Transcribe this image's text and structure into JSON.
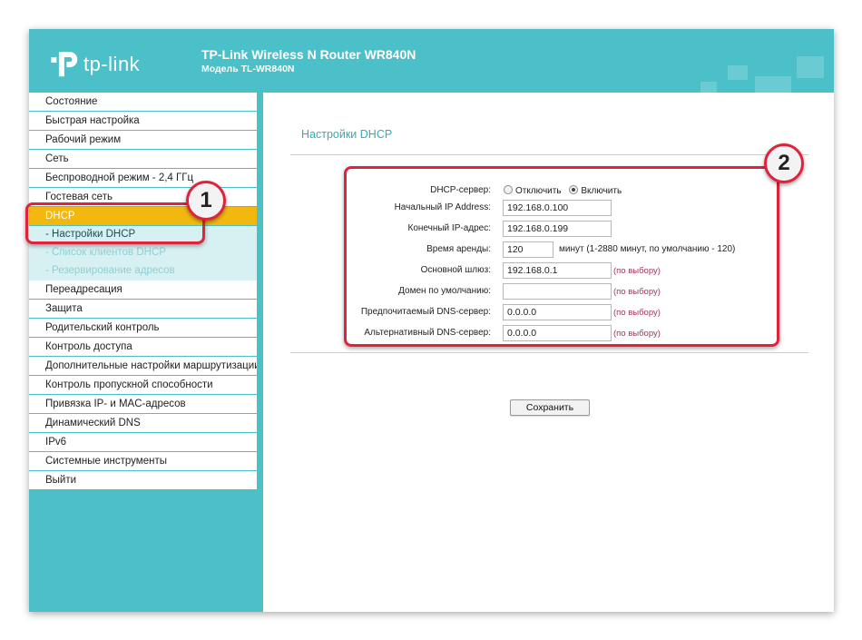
{
  "header": {
    "logo_text": "tp-link",
    "product_title": "TP-Link Wireless N Router WR840N",
    "product_model": "Модель TL-WR840N",
    "logo_icon": "tp-link-logo-icon"
  },
  "sidebar": {
    "items": [
      {
        "label": "Состояние"
      },
      {
        "label": "Быстрая настройка"
      },
      {
        "label": "Рабочий режим"
      },
      {
        "label": "Сеть"
      },
      {
        "label": "Беспроводной режим - 2,4 ГГц"
      },
      {
        "label": "Гостевая сеть"
      },
      {
        "label": "DHCP"
      },
      {
        "label": "- Настройки DHCP"
      },
      {
        "label": "- Список клиентов DHCP"
      },
      {
        "label": "- Резервирование адресов"
      },
      {
        "label": "Переадресация"
      },
      {
        "label": "Защита"
      },
      {
        "label": "Родительский контроль"
      },
      {
        "label": "Контроль доступа"
      },
      {
        "label": "Дополнительные настройки маршрутизации"
      },
      {
        "label": "Контроль пропускной способности"
      },
      {
        "label": "Привязка IP- и MAC-адресов"
      },
      {
        "label": "Динамический DNS"
      },
      {
        "label": "IPv6"
      },
      {
        "label": "Системные инструменты"
      },
      {
        "label": "Выйти"
      }
    ]
  },
  "main": {
    "title": "Настройки DHCP",
    "form": {
      "dhcp_server_label": "DHCP-сервер:",
      "dhcp_off_label": "Отключить",
      "dhcp_on_label": "Включить",
      "dhcp_selected": "Включить",
      "start_ip_label": "Начальный IP Address:",
      "start_ip_value": "192.168.0.100",
      "end_ip_label": "Конечный IP-адрес:",
      "end_ip_value": "192.168.0.199",
      "lease_label": "Время аренды:",
      "lease_value": "120",
      "lease_hint": "минут (1-2880 минут, по умолчанию - 120)",
      "gateway_label": "Основной шлюз:",
      "gateway_value": "192.168.0.1",
      "gateway_hint": "(по выбору)",
      "domain_label": "Домен по умолчанию:",
      "domain_value": "",
      "domain_hint": "(по выбору)",
      "dns1_label": "Предпочитаемый DNS-сервер:",
      "dns1_value": "0.0.0.0",
      "dns1_hint": "(по выбору)",
      "dns2_label": "Альтернативный DNS-сервер:",
      "dns2_value": "0.0.0.0",
      "dns2_hint": "(по выбору)"
    },
    "save_label": "Сохранить"
  },
  "annotations": {
    "callout_1": "1",
    "callout_2": "2",
    "color": "#e0223a"
  },
  "colors": {
    "brand": "#4bc0c8",
    "active_menu": "#f3b80f",
    "hint": "#a8325a",
    "title": "#3aa8b4"
  }
}
